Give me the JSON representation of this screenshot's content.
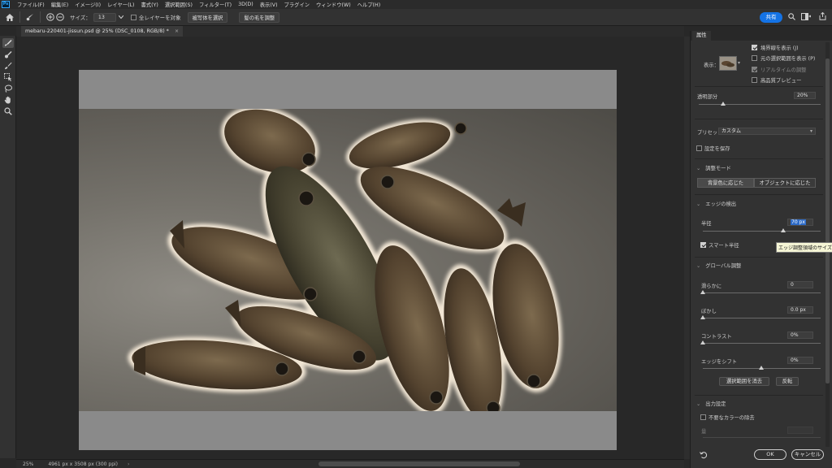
{
  "menu": [
    "ファイル(F)",
    "編集(E)",
    "イメージ(I)",
    "レイヤー(L)",
    "書式(Y)",
    "選択範囲(S)",
    "フィルター(T)",
    "3D(D)",
    "表示(V)",
    "プラグイン",
    "ウィンドウ(W)",
    "ヘルプ(H)"
  ],
  "options": {
    "size_label": "サイズ：",
    "size_value": "13",
    "all_layers": "全レイヤーを対象",
    "select_subject": "被写体を選択",
    "refine_hair": "髪の毛を調整",
    "share": "共有"
  },
  "document": {
    "tab_title": "mebaru-220401-jissun.psd @ 25% (DSC_0108, RGB/8) *",
    "zoom": "25%",
    "dimensions": "4961 px x 3508 px (300 ppi)"
  },
  "panel": {
    "title": "属性",
    "view_label": "表示：",
    "view_opts": [
      "境界線を表示 (J)",
      "元の選択範囲を表示 (P)",
      "リアルタイムの調整",
      "高品質プレビュー"
    ],
    "opacity_label": "透明部分",
    "opacity_value": "20%",
    "opacity_fraction": 0.2,
    "preset_label": "プリセット",
    "preset_value": "カスタム",
    "save_settings": "設定を保存",
    "mode_section": "調整モード",
    "mode_color": "背景色に応じた",
    "mode_object": "オブジェクトに応じた",
    "edge_section": "エッジの検出",
    "radius_label": "半径",
    "radius_value": "70 px",
    "smart_radius": "スマート半径",
    "tooltip": "エッジ調整領域のサイズ",
    "global_section": "グローバル調整",
    "smooth_label": "滑らかに",
    "smooth_value": "0",
    "feather_label": "ぼかし",
    "feather_value": "0.0 px",
    "contrast_label": "コントラスト",
    "contrast_value": "0%",
    "shift_label": "エッジをシフト",
    "shift_value": "0%",
    "clear_selection": "選択範囲を消去",
    "invert": "反転",
    "output_section": "出力設定",
    "decontaminate": "不要なカラーの除去",
    "amount_label": "量",
    "ok": "OK",
    "cancel": "キャンセル"
  },
  "colors": {
    "accent": "#1473e6",
    "panel_bg": "#323232",
    "canvas_bg": "#282828"
  }
}
